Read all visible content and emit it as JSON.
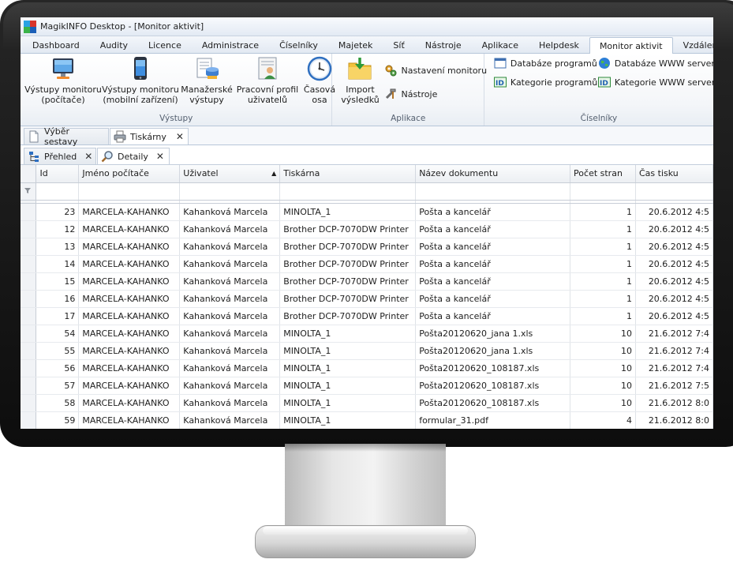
{
  "window": {
    "title": "MagikINFO Desktop - [Monitor aktivit]"
  },
  "ribbon_tabs": [
    "Dashboard",
    "Audity",
    "Licence",
    "Administrace",
    "Číselníky",
    "Majetek",
    "Síť",
    "Nástroje",
    "Aplikace",
    "Helpdesk",
    "Monitor aktivit",
    "Vzdálené distribuce"
  ],
  "active_tab": "Monitor aktivit",
  "groups": {
    "vystupy": {
      "label": "Výstupy",
      "buttons": [
        {
          "line1": "Výstupy monitoru",
          "line2": "(počítače)",
          "icon": "monitor-icon"
        },
        {
          "line1": "Výstupy monitoru",
          "line2": "(mobilní zařízení)",
          "icon": "mobile-phone-icon"
        },
        {
          "line1": "Manažerské",
          "line2": "výstupy",
          "icon": "manager-reports-icon"
        },
        {
          "line1": "Pracovní profil",
          "line2": "uživatelů",
          "icon": "user-profile-icon"
        },
        {
          "line1": "Časová",
          "line2": "osa",
          "icon": "clock-icon"
        }
      ]
    },
    "aplikace": {
      "label": "Aplikace",
      "import": {
        "line1": "Import",
        "line2": "výsledků",
        "icon": "import-folder-icon"
      },
      "nastaveni": "Nastavení monitoru",
      "nastroje": "Nástroje"
    },
    "ciselniky": {
      "label": "Číselníky",
      "items": [
        "Databáze programů",
        "Kategorie programů",
        "Databáze WWW serverů",
        "Kategorie WWW serverů"
      ]
    }
  },
  "doc_tabs": [
    {
      "label": "Výběr sestavy",
      "icon": "document-icon"
    },
    {
      "label": "Tiskárny",
      "icon": "printer-icon",
      "close": "✕"
    }
  ],
  "sub_tabs": [
    {
      "label": "Přehled",
      "icon": "tree-overview-icon",
      "close": "✕"
    },
    {
      "label": "Detaily",
      "icon": "magnifier-icon",
      "close": "✕"
    }
  ],
  "table": {
    "columns": [
      "Id",
      "Jméno počítače",
      "Uživatel",
      "Tiskárna",
      "Název dokumentu",
      "Počet stran",
      "Čas tisku"
    ],
    "rows": [
      [
        "23",
        "MARCELA-KAHANKO",
        "Kahanková Marcela",
        "MINOLTA_1",
        "Pošta a kancelář",
        "1",
        "20.6.2012 4:5"
      ],
      [
        "12",
        "MARCELA-KAHANKO",
        "Kahanková Marcela",
        "Brother DCP-7070DW Printer",
        "Pošta a kancelář",
        "1",
        "20.6.2012 4:5"
      ],
      [
        "13",
        "MARCELA-KAHANKO",
        "Kahanková Marcela",
        "Brother DCP-7070DW Printer",
        "Pošta a kancelář",
        "1",
        "20.6.2012 4:5"
      ],
      [
        "14",
        "MARCELA-KAHANKO",
        "Kahanková Marcela",
        "Brother DCP-7070DW Printer",
        "Pošta a kancelář",
        "1",
        "20.6.2012 4:5"
      ],
      [
        "15",
        "MARCELA-KAHANKO",
        "Kahanková Marcela",
        "Brother DCP-7070DW Printer",
        "Pošta a kancelář",
        "1",
        "20.6.2012 4:5"
      ],
      [
        "16",
        "MARCELA-KAHANKO",
        "Kahanková Marcela",
        "Brother DCP-7070DW Printer",
        "Pošta a kancelář",
        "1",
        "20.6.2012 4:5"
      ],
      [
        "17",
        "MARCELA-KAHANKO",
        "Kahanková Marcela",
        "Brother DCP-7070DW Printer",
        "Pošta a kancelář",
        "1",
        "20.6.2012 4:5"
      ],
      [
        "54",
        "MARCELA-KAHANKO",
        "Kahanková Marcela",
        "MINOLTA_1",
        "Pošta20120620_jana 1.xls",
        "10",
        "21.6.2012 7:4"
      ],
      [
        "55",
        "MARCELA-KAHANKO",
        "Kahanková Marcela",
        "MINOLTA_1",
        "Pošta20120620_jana 1.xls",
        "10",
        "21.6.2012 7:4"
      ],
      [
        "56",
        "MARCELA-KAHANKO",
        "Kahanková Marcela",
        "MINOLTA_1",
        "Pošta20120620_108187.xls",
        "10",
        "21.6.2012 7:4"
      ],
      [
        "57",
        "MARCELA-KAHANKO",
        "Kahanková Marcela",
        "MINOLTA_1",
        "Pošta20120620_108187.xls",
        "10",
        "21.6.2012 7:5"
      ],
      [
        "58",
        "MARCELA-KAHANKO",
        "Kahanková Marcela",
        "MINOLTA_1",
        "Pošta20120620_108187.xls",
        "10",
        "21.6.2012 8:0"
      ],
      [
        "59",
        "MARCELA-KAHANKO",
        "Kahanková Marcela",
        "MINOLTA_1",
        "formular_31.pdf",
        "4",
        "21.6.2012 8:0"
      ]
    ]
  },
  "colors": {
    "accent": "#1c5fb8",
    "tab_border": "#b7c6d9"
  }
}
